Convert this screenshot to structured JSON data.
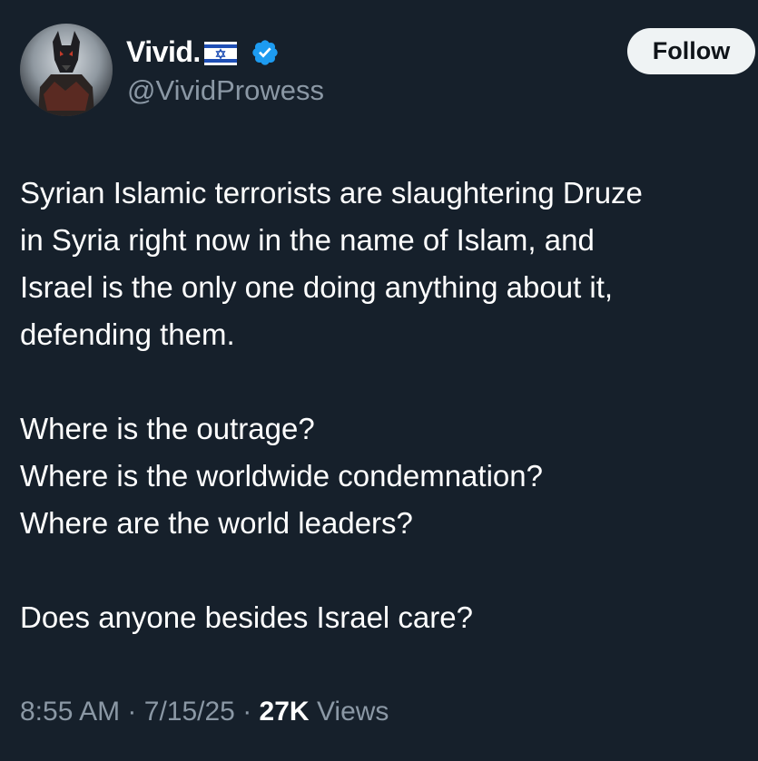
{
  "author": {
    "display_name": "Vivid.",
    "flag_icon": "israel-flag-icon",
    "verified_icon": "verified-badge-icon",
    "verified_color": "#1d9bf0",
    "handle": "@VividProwess"
  },
  "follow_button": {
    "label": "Follow"
  },
  "tweet": {
    "lines": [
      "Syrian Islamic terrorists are slaughtering Druze",
      "in Syria right now in the name of Islam, and",
      "Israel is the only one doing anything about it,",
      "defending them.",
      "Where is the outrage?",
      "Where is the worldwide condemnation?",
      "Where are the world leaders?",
      "Does anyone besides Israel care?"
    ]
  },
  "meta": {
    "time": "8:55 AM",
    "separator": "·",
    "date": "7/15/25",
    "views_count": "27K",
    "views_label": "Views"
  },
  "colors": {
    "background": "#16202b",
    "text_primary": "#ffffff",
    "text_secondary": "#8b98a5",
    "button_bg": "#eff3f4",
    "button_text": "#0f1419"
  }
}
